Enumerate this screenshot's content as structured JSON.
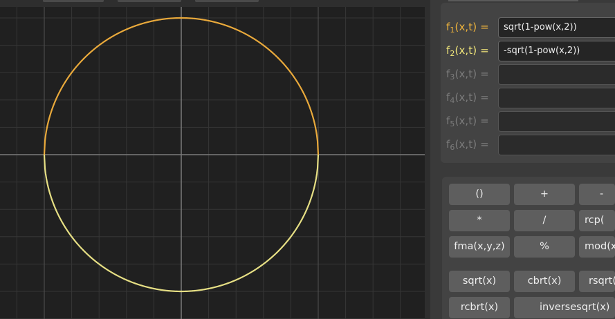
{
  "colors": {
    "f1_curve": "#e9a93b",
    "f2_curve": "#e6df84",
    "f1_label": "#f0b43c",
    "f2_label": "#f2e77a",
    "inactive_label": "#7c7c7c",
    "graph_background": "#202020"
  },
  "functions": [
    {
      "name": "f",
      "sub": "1",
      "args": "(x,t) =",
      "expression": "sqrt(1-pow(x,2))",
      "active": true
    },
    {
      "name": "f",
      "sub": "2",
      "args": "(x,t) =",
      "expression": "-sqrt(1-pow(x,2))",
      "active": true
    },
    {
      "name": "f",
      "sub": "3",
      "args": "(x,t) =",
      "expression": "",
      "active": false
    },
    {
      "name": "f",
      "sub": "4",
      "args": "(x,t) =",
      "expression": "",
      "active": false
    },
    {
      "name": "f",
      "sub": "5",
      "args": "(x,t) =",
      "expression": "",
      "active": false
    },
    {
      "name": "f",
      "sub": "6",
      "args": "(x,t) =",
      "expression": "",
      "active": false
    }
  ],
  "keypad": {
    "row1": [
      "()",
      "+",
      "-"
    ],
    "row2": [
      "*",
      "/",
      "rcp("
    ],
    "row3": [
      "fma(x,y,z)",
      "%",
      "mod(x"
    ],
    "row4": [
      "sqrt(x)",
      "cbrt(x)",
      "rsqrt("
    ],
    "row5": [
      "rcbrt(x)",
      "inversesqrt(x)"
    ]
  }
}
